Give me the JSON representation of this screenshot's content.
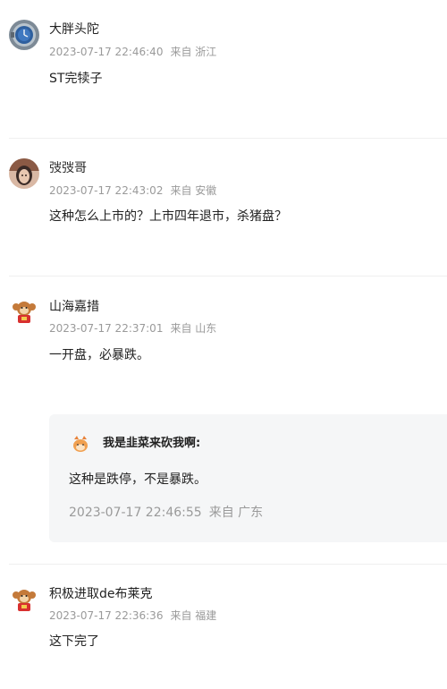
{
  "comments": [
    {
      "username": "大胖头陀",
      "time": "2023-07-17 22:46:40",
      "location": "来自 浙江",
      "content": "ST完犊子",
      "avatar_icon": "watch-photo-avatar"
    },
    {
      "username": "弢弢哥",
      "time": "2023-07-17 22:43:02",
      "location": "来自 安徽",
      "content": "这种怎么上市的？上市四年退市，杀猪盘？",
      "avatar_icon": "portrait-photo-avatar"
    },
    {
      "username": "山海嘉措",
      "time": "2023-07-17 22:37:01",
      "location": "来自 山东",
      "content": "一开盘，必暴跌。",
      "avatar_icon": "cartoon-monkey-avatar",
      "reply": {
        "username": "我是韭菜来砍我啊:",
        "content": "这种是跌停，不是暴跌。",
        "time": "2023-07-17 22:46:55",
        "location": "来自 广东",
        "avatar_icon": "cartoon-cat-avatar"
      }
    },
    {
      "username": "积极进取de布莱克",
      "time": "2023-07-17 22:36:36",
      "location": "来自 福建",
      "content": "这下完了",
      "avatar_icon": "cartoon-monkey-avatar"
    }
  ],
  "colors": {
    "text": "#222222",
    "meta": "#9a9a9a",
    "reply_bg": "#f5f6f7",
    "divider": "#efefef"
  }
}
